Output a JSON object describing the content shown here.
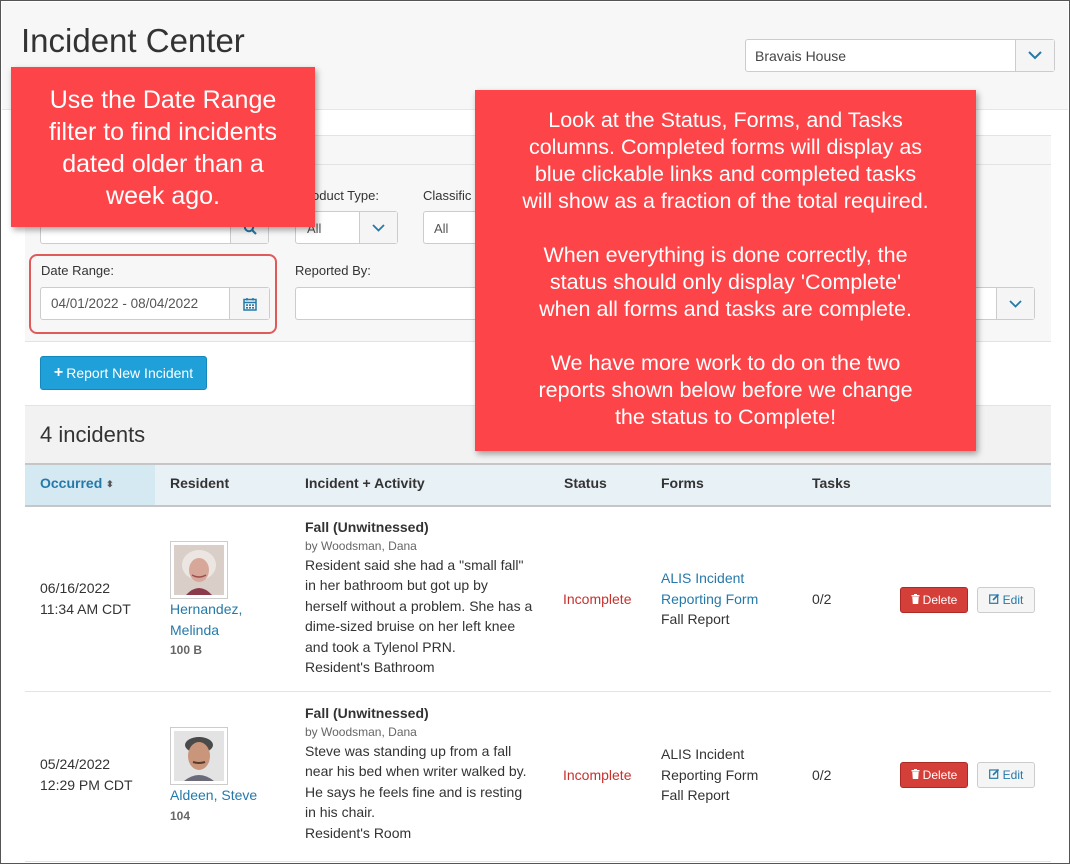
{
  "header": {
    "title": "Incident Center",
    "facility": "Bravais House"
  },
  "filters": {
    "product_type_label": "oduct Type:",
    "product_type_value": "All",
    "classification_label": "Classific",
    "classification_value": "All",
    "date_range_label": "Date Range:",
    "date_range_value": "04/01/2022 - 08/04/2022",
    "reported_by_label": "Reported By:"
  },
  "actions": {
    "report_new": "Report New Incident"
  },
  "summary": {
    "count": "4 incidents"
  },
  "table": {
    "headers": {
      "occurred": "Occurred",
      "resident": "Resident",
      "incident": "Incident + Activity",
      "status": "Status",
      "forms": "Forms",
      "tasks": "Tasks"
    },
    "rows": [
      {
        "date": "06/16/2022",
        "time": "11:34 AM CDT",
        "resident_last": "Hernandez,",
        "resident_first": "Melinda",
        "room": "100 B",
        "incident_title": "Fall (Unwitnessed)",
        "by": "by Woodsman, Dana",
        "desc_lines": [
          "Resident said she had a \"small fall\"",
          "in her bathroom but got up by",
          "herself without a problem. She has a",
          "dime-sized bruise on her left knee",
          "and took a Tylenol PRN."
        ],
        "location": "Resident's Bathroom",
        "status": "Incomplete",
        "form_line1": "ALIS Incident",
        "form_line2": "Reporting Form",
        "form_line3": "Fall Report",
        "tasks": "0/2",
        "delete_label": "Delete",
        "edit_label": "Edit"
      },
      {
        "date": "05/24/2022",
        "time": "12:29 PM CDT",
        "resident_name": "Aldeen, Steve",
        "room": "104",
        "incident_title": "Fall (Unwitnessed)",
        "by": "by Woodsman, Dana",
        "desc_lines": [
          "Steve was standing up from a fall",
          "near his bed when writer walked by.",
          "He says he feels fine and is resting",
          "in his chair."
        ],
        "location": "Resident's Room",
        "status": "Incomplete",
        "form_line1": "ALIS Incident",
        "form_line2": "Reporting Form",
        "form_line3": "Fall Report",
        "tasks": "0/2",
        "delete_label": "Delete",
        "edit_label": "Edit"
      }
    ]
  },
  "callouts": {
    "left_lines": [
      "Use the Date Range",
      "filter to find incidents",
      "dated older than a",
      "week ago."
    ],
    "right_p1": [
      "Look at the Status, Forms, and Tasks",
      "columns. Completed forms will display as",
      "blue clickable links and completed tasks",
      "will show as a fraction of the total required."
    ],
    "right_p2": [
      "When everything is done correctly, the",
      "status should only display 'Complete'",
      "when all forms and tasks are complete."
    ],
    "right_p3": [
      "We have more work to do on the two",
      "reports shown below before we change",
      "the status to Complete!"
    ]
  },
  "colors": {
    "callout": "#fd4549",
    "primary": "#1fa0d8",
    "link": "#2579a9",
    "danger": "#d43f3a"
  }
}
